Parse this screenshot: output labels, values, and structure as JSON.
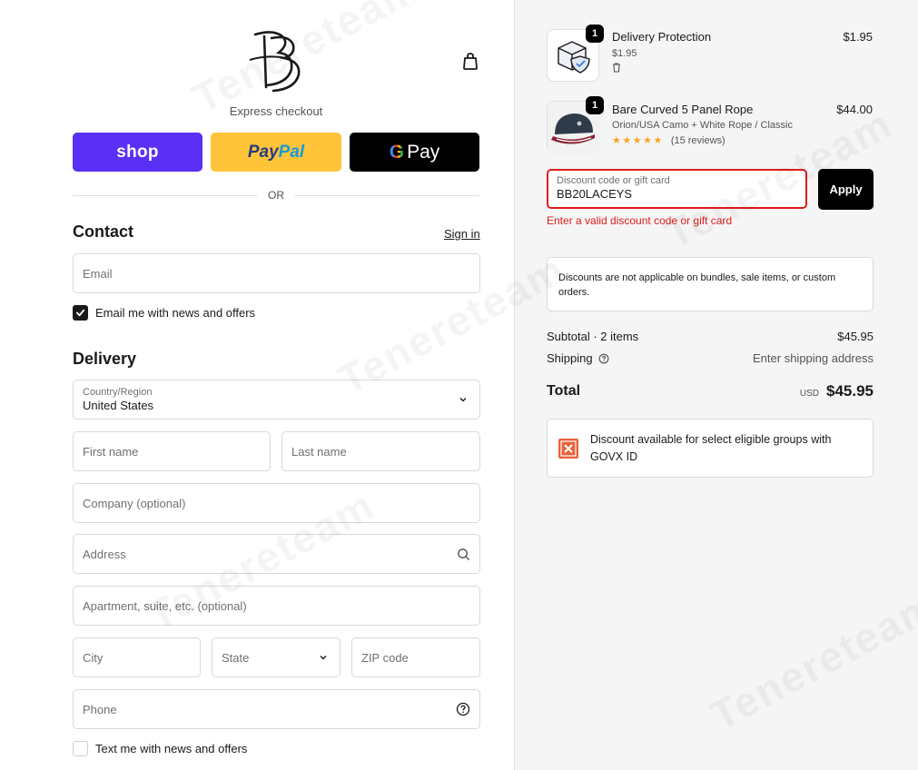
{
  "checkout": {
    "express_label": "Express checkout",
    "shop_label": "shop",
    "paypal_part1": "Pay",
    "paypal_part2": "Pal",
    "gpay_label": "Pay",
    "or_label": "OR"
  },
  "contact": {
    "heading": "Contact",
    "signin": "Sign in",
    "email_placeholder": "Email",
    "news_label": "Email me with news and offers",
    "news_checked": true
  },
  "delivery": {
    "heading": "Delivery",
    "country_label": "Country/Region",
    "country_value": "United States",
    "first_name": "First name",
    "last_name": "Last name",
    "company": "Company (optional)",
    "address": "Address",
    "apartment": "Apartment, suite, etc. (optional)",
    "city": "City",
    "state": "State",
    "zip": "ZIP code",
    "phone": "Phone",
    "sms_label": "Text me with news and offers"
  },
  "cart": {
    "items": [
      {
        "qty": "1",
        "name": "Delivery Protection",
        "sub": "$1.95",
        "price": "$1.95"
      },
      {
        "qty": "1",
        "name": "Bare Curved 5 Panel Rope",
        "sub": "Orion/USA Camo + White Rope / Classic",
        "rating_text": "(15 reviews)",
        "stars": 5,
        "price": "$44.00"
      }
    ]
  },
  "discount": {
    "label": "Discount code or gift card",
    "value": "BB20LACEYS",
    "apply": "Apply",
    "error": "Enter a valid discount code or gift card",
    "notice": "Discounts are not applicable on bundles, sale items, or custom orders."
  },
  "summary": {
    "subtotal_label": "Subtotal · 2 items",
    "subtotal_value": "$45.95",
    "shipping_label": "Shipping",
    "shipping_value": "Enter shipping address",
    "total_label": "Total",
    "currency": "USD",
    "total_value": "$45.95"
  },
  "govx": {
    "text": "Discount available for select eligible groups with GOVX ID"
  },
  "colors": {
    "shop": "#5a31f4",
    "paypal": "#ffc439",
    "error": "#dd1d1d",
    "stars": "#f5a623"
  }
}
